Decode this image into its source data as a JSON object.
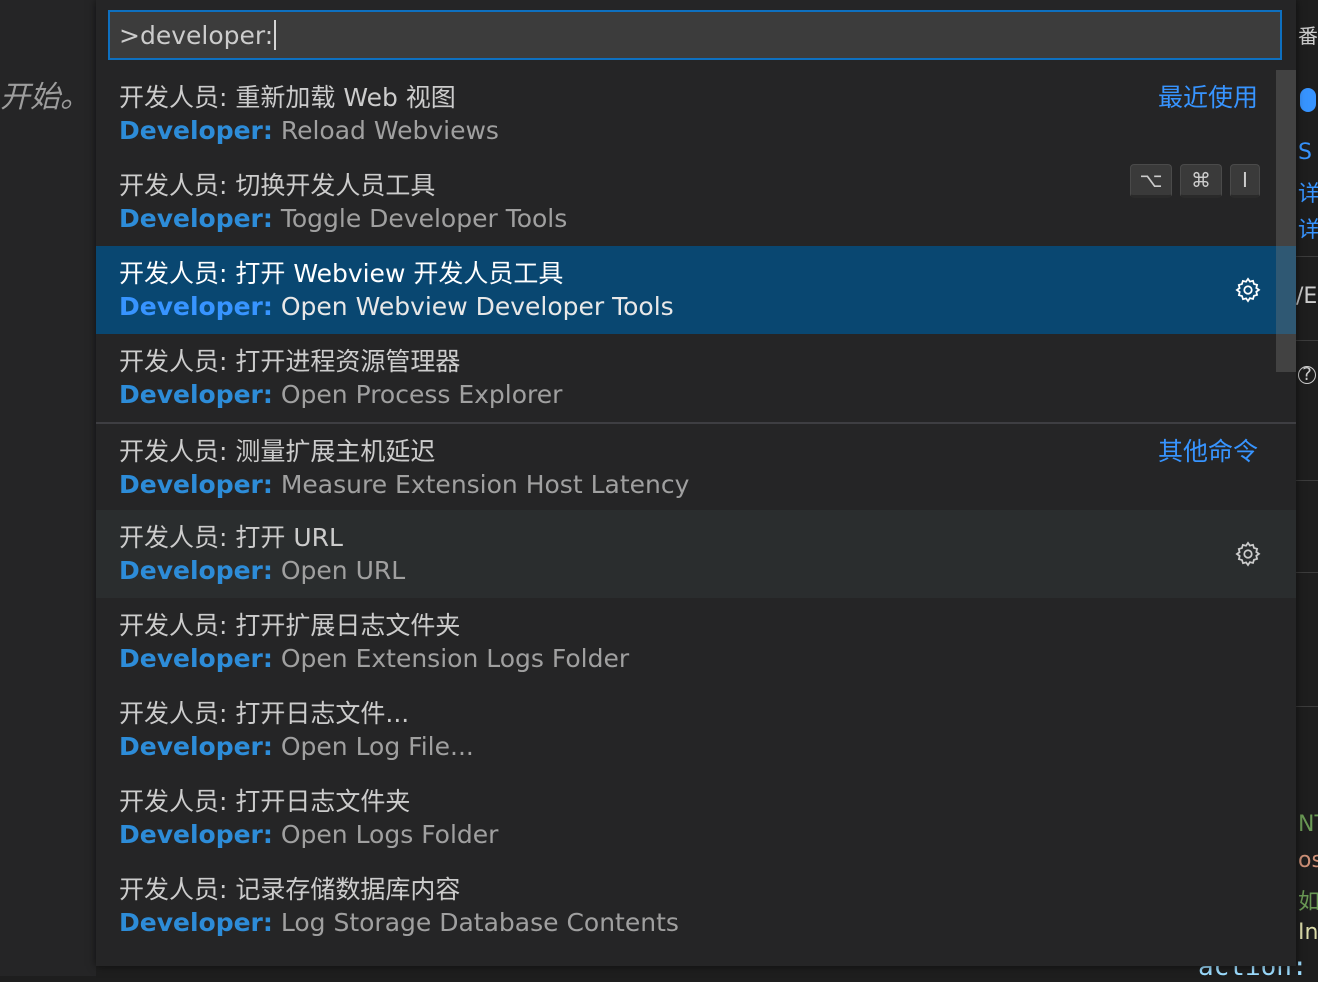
{
  "background": {
    "left_text": "开始。",
    "right_fragments": [
      "番",
      "S",
      "详",
      "详",
      "/E",
      "?",
      "NT",
      "os",
      "如",
      "In"
    ],
    "bottom_code": "action:"
  },
  "quick_pick": {
    "input_value": ">developer:",
    "items": [
      {
        "zh": "开发人员: 重新加载 Web 视图",
        "prefix": "Developer:",
        "label": "Reload Webviews",
        "right_label": "最近使用"
      },
      {
        "zh": "开发人员: 切换开发人员工具",
        "prefix": "Developer:",
        "label": "Toggle Developer Tools",
        "keys": [
          "⌥",
          "⌘",
          "I"
        ]
      },
      {
        "zh": "开发人员: 打开 Webview 开发人员工具",
        "prefix": "Developer:",
        "label": "Open Webview Developer Tools",
        "icon": "gear-icon"
      },
      {
        "zh": "开发人员: 打开进程资源管理器",
        "prefix": "Developer:",
        "label": "Open Process Explorer"
      },
      {
        "zh": "开发人员: 测量扩展主机延迟",
        "prefix": "Developer:",
        "label": "Measure Extension Host Latency",
        "right_label": "其他命令"
      },
      {
        "zh": "开发人员: 打开 URL",
        "prefix": "Developer:",
        "label": "Open URL",
        "icon": "gear-icon"
      },
      {
        "zh": "开发人员: 打开扩展日志文件夹",
        "prefix": "Developer:",
        "label": "Open Extension Logs Folder"
      },
      {
        "zh": "开发人员: 打开日志文件...",
        "prefix": "Developer:",
        "label": "Open Log File..."
      },
      {
        "zh": "开发人员: 打开日志文件夹",
        "prefix": "Developer:",
        "label": "Open Logs Folder"
      },
      {
        "zh": "开发人员: 记录存储数据库内容",
        "prefix": "Developer:",
        "label": "Log Storage Database Contents"
      }
    ]
  },
  "colors": {
    "accent": "#3794ff",
    "selection": "#094771",
    "prefix": "#2d8cd8"
  }
}
